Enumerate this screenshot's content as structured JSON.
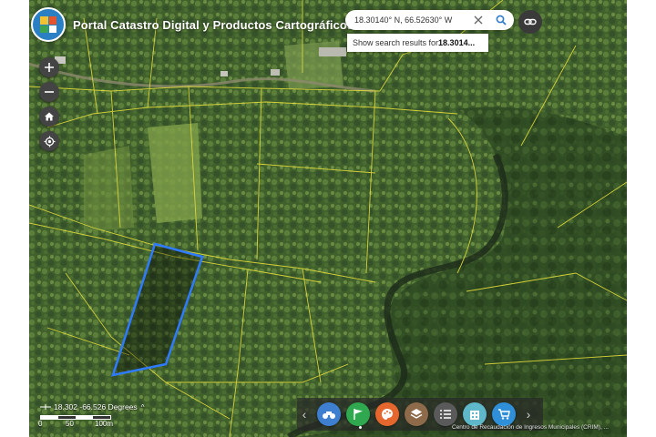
{
  "app": {
    "title": "Portal Catastro Digital y Productos Cartográficos"
  },
  "search": {
    "value": "18.30140° N, 66.52630° W",
    "suggestion_prefix": "Show search results for ",
    "suggestion_query": "18.3014..."
  },
  "controls": {
    "zoom_in": "+",
    "zoom_out": "−"
  },
  "coords": {
    "readout": "18.302 -66.526 Degrees",
    "caret": "^"
  },
  "scale": {
    "labels": [
      "0",
      "50",
      "100m"
    ]
  },
  "toolbar": {
    "prev": "‹",
    "next": "›",
    "tools": [
      {
        "icon": "binoculars-icon",
        "color": "#3f7fd0"
      },
      {
        "icon": "flag-icon",
        "color": "#2fa84f"
      },
      {
        "icon": "palette-icon",
        "color": "#e5672d"
      },
      {
        "icon": "layers-icon",
        "color": "#8d6a4a"
      },
      {
        "icon": "list-icon",
        "color": "#5a5a5a"
      },
      {
        "icon": "building-icon",
        "color": "#5fb8c9"
      },
      {
        "icon": "cart-icon",
        "color": "#2f8fd8"
      }
    ]
  },
  "attribution": "Centro de Recaudación de Ingresos Municipales (CRIM), ...",
  "colors": {
    "parcel_line": "#e3de3a",
    "selection": "#2f7bff",
    "header_text": "#ffffff"
  }
}
